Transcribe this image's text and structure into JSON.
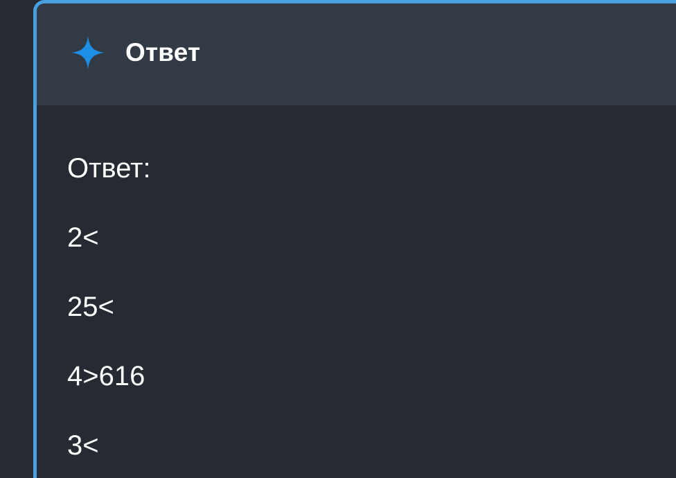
{
  "header": {
    "icon": "sparkle-icon",
    "title": "Ответ"
  },
  "body": {
    "lines": [
      "Ответ:",
      "2<",
      "25<",
      "4>616",
      "3<"
    ]
  },
  "colors": {
    "accent": "#4a9fe0",
    "sparkle": "#1d8fe6",
    "header_bg": "#323b45",
    "body_bg": "#262b33",
    "text": "#ffffff"
  }
}
